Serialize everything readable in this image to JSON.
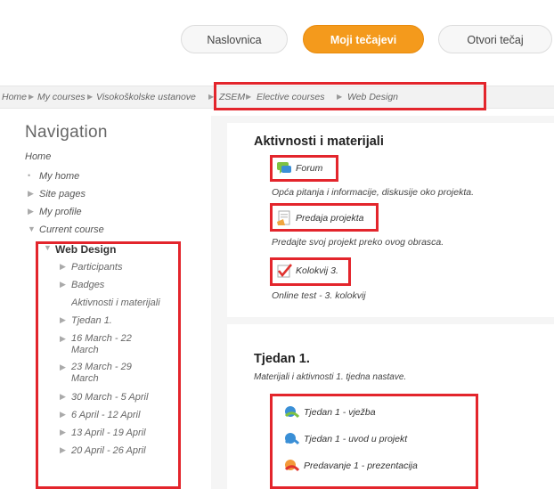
{
  "top_nav": {
    "home_label": "Naslovnica",
    "my_courses_label": "Moji tečajevi",
    "open_course_label": "Otvori tečaj"
  },
  "breadcrumb": {
    "items": [
      "Home",
      "My courses",
      "Visokoškolske ustanove",
      "ZSEM",
      "Elective courses",
      "Web Design"
    ],
    "separator": "▶"
  },
  "navigation": {
    "title": "Navigation",
    "home": "Home",
    "my_home": "My home",
    "site_pages": "Site pages",
    "my_profile": "My profile",
    "current_course": "Current course",
    "course_name": "Web Design",
    "course_items": [
      "Participants",
      "Badges",
      "Aktivnosti i materijali",
      "Tjedan 1.",
      "16 March - 22 March",
      "23 March - 29 March",
      "30 March - 5 April",
      "6 April - 12 April",
      "13 April - 19 April",
      "20 April - 26 April"
    ]
  },
  "sections": [
    {
      "title": "Aktivnosti i materijali",
      "activities": [
        {
          "label": "Forum",
          "icon": "forum-icon",
          "description": "Opća pitanja i informacije, diskusije oko projekta."
        },
        {
          "label": "Predaja projekta",
          "icon": "assignment-icon",
          "description": "Predajte svoj projekt preko ovog obrasca."
        },
        {
          "label": "Kolokvij 3.",
          "icon": "quiz-icon",
          "description": "Online test - 3. kolokvij"
        }
      ]
    },
    {
      "title": "Tjedan 1.",
      "summary": "Materijali i aktivnosti 1. tjedna nastave.",
      "activities": [
        {
          "label": "Tjedan 1 - vježba",
          "icon": "resource-icon"
        },
        {
          "label": "Tjedan 1 - uvod u projekt",
          "icon": "resource-icon"
        },
        {
          "label": "Predavanje 1 - prezentacija",
          "icon": "presentation-icon"
        }
      ]
    }
  ],
  "colors": {
    "accent": "#f49a1c",
    "highlight": "#e3252c"
  }
}
